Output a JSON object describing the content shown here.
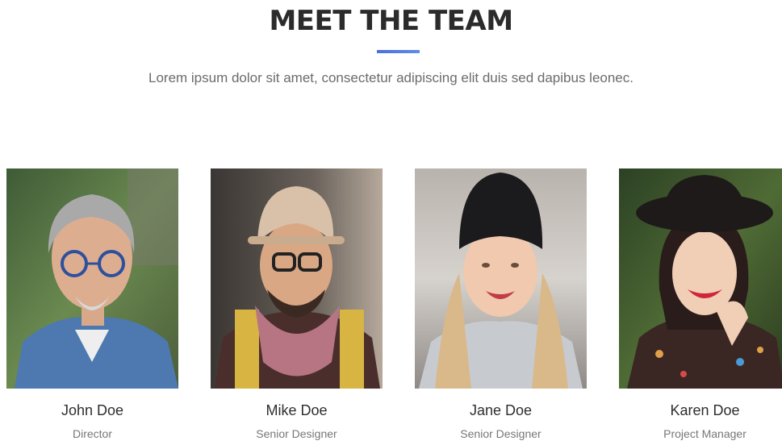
{
  "section": {
    "title": "MEET THE TEAM",
    "subtitle": "Lorem ipsum dolor sit amet, consectetur adipiscing elit duis sed dapibus leonec.",
    "accent_color": "#4c6fe0"
  },
  "team": [
    {
      "name": "John Doe",
      "role": "Director"
    },
    {
      "name": "Mike Doe",
      "role": "Senior Designer"
    },
    {
      "name": "Jane Doe",
      "role": "Senior Designer"
    },
    {
      "name": "Karen Doe",
      "role": "Project Manager"
    }
  ]
}
